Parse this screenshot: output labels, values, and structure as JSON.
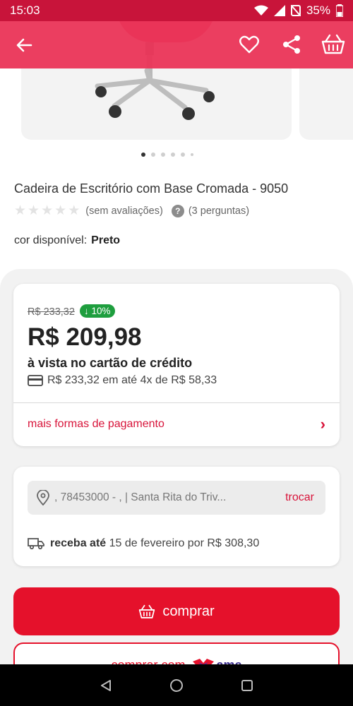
{
  "status_bar": {
    "time": "15:03",
    "battery": "35%",
    "icons": [
      "wifi-icon",
      "signal-icon",
      "no-sim-icon",
      "battery-icon"
    ]
  },
  "app_bar": {
    "back_icon": "arrow-left-icon",
    "actions": [
      "heart-icon",
      "share-icon",
      "basket-icon"
    ]
  },
  "gallery": {
    "total_dots": 6,
    "active_index": 0
  },
  "product": {
    "title": "Cadeira de Escritório com Base Cromada - 9050",
    "rating_label": "(sem avaliações)",
    "questions_label": "(3 perguntas)",
    "color_label": "cor disponível:",
    "color_value": "Preto"
  },
  "price_card": {
    "old_price": "R$ 233,32",
    "discount": "↓ 10%",
    "price": "R$ 209,98",
    "price_subtitle": "à vista no cartão de crédito",
    "installments": "R$ 233,32 em até 4x de R$ 58,33",
    "more_payments": "mais formas de pagamento"
  },
  "shipping": {
    "address": ", 78453000 - ,  | Santa Rita do Triv...",
    "change": "trocar",
    "delivery_bold": "receba até",
    "delivery_text": "15 de fevereiro por R$ 308,30"
  },
  "buttons": {
    "buy": "comprar",
    "buy_with_ame": "comprar com",
    "ame_brand": "ame"
  },
  "colors": {
    "brand_red": "#e5112b",
    "app_bar_pink": "#ea365a",
    "discount_green": "#1e9e3e"
  }
}
